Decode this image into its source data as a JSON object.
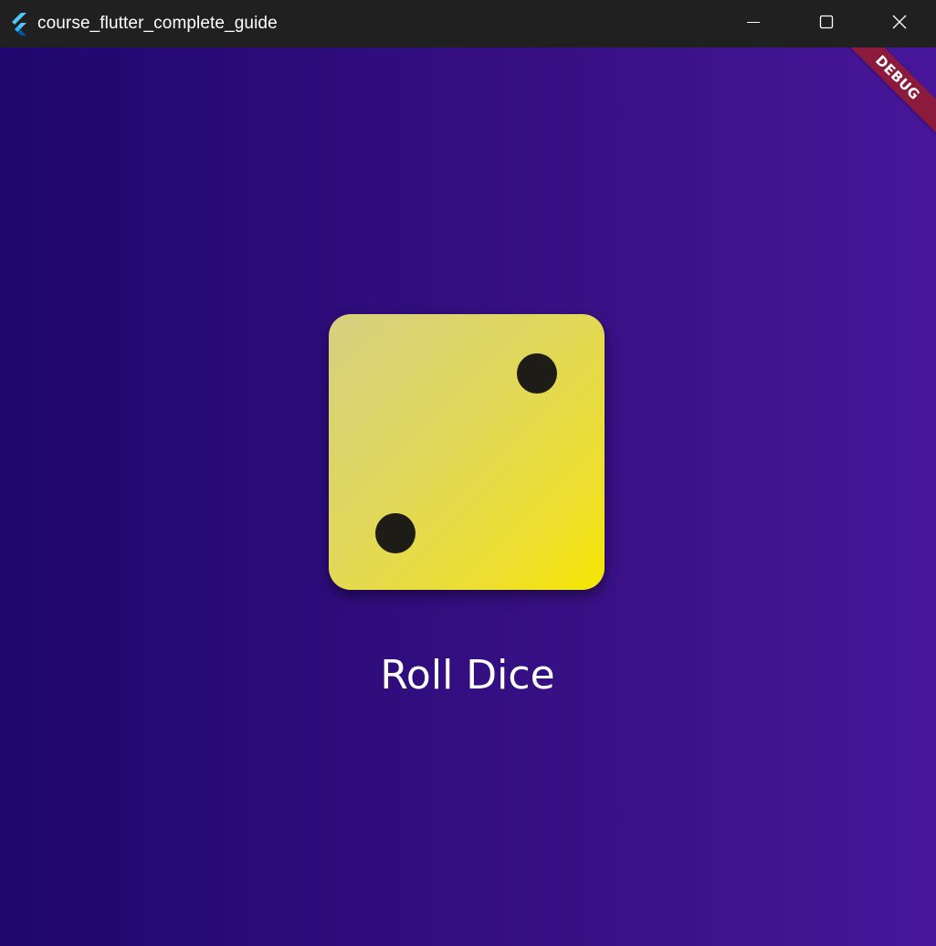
{
  "window": {
    "title": "course_flutter_complete_guide",
    "logo_icon": "flutter-logo-icon",
    "controls": {
      "minimize_icon": "minimize-icon",
      "maximize_icon": "maximize-icon",
      "close_icon": "close-icon"
    }
  },
  "app": {
    "debug_banner": "DEBUG",
    "dice": {
      "value": 2,
      "color_start": "#d6cf80",
      "color_end": "#f6e600",
      "pip_color": "#1e1c17"
    },
    "roll_button_label": "Roll Dice",
    "background_gradient": [
      "#1f066e",
      "#47169a"
    ]
  }
}
